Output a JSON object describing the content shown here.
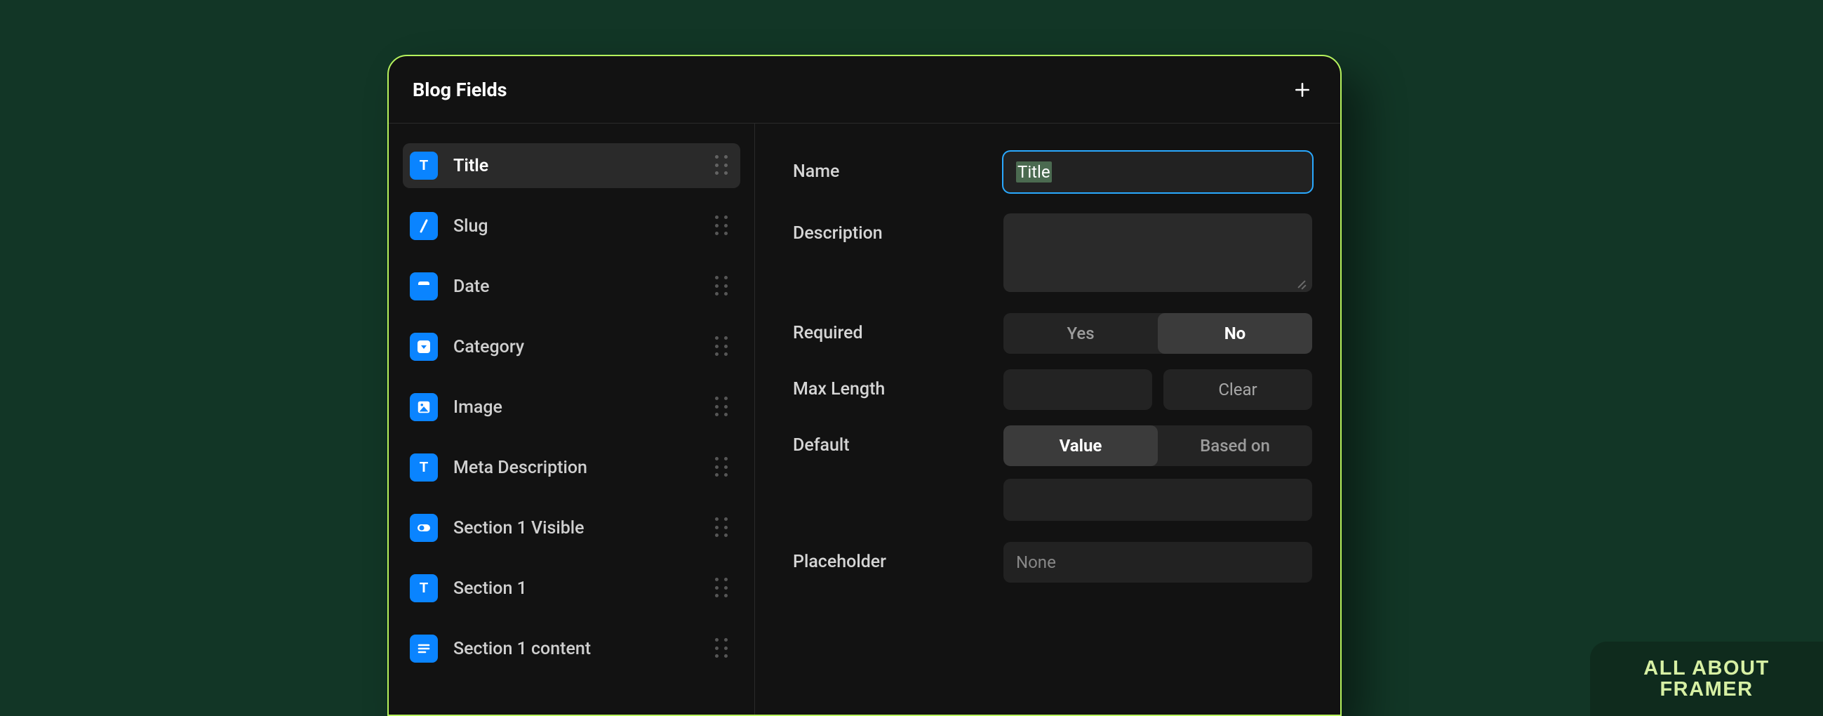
{
  "panel": {
    "title": "Blog Fields"
  },
  "fields": {
    "items": [
      {
        "label": "Title",
        "icon": "text",
        "selected": true
      },
      {
        "label": "Slug",
        "icon": "slash",
        "selected": false
      },
      {
        "label": "Date",
        "icon": "date",
        "selected": false
      },
      {
        "label": "Category",
        "icon": "dropdown",
        "selected": false
      },
      {
        "label": "Image",
        "icon": "image",
        "selected": false
      },
      {
        "label": "Meta Description",
        "icon": "text",
        "selected": false
      },
      {
        "label": "Section 1 Visible",
        "icon": "toggle",
        "selected": false
      },
      {
        "label": "Section 1",
        "icon": "text",
        "selected": false
      },
      {
        "label": "Section 1 content",
        "icon": "richtext",
        "selected": false
      }
    ]
  },
  "form": {
    "name": {
      "label": "Name",
      "value": "Title"
    },
    "description": {
      "label": "Description",
      "value": ""
    },
    "required": {
      "label": "Required",
      "options": {
        "yes": "Yes",
        "no": "No"
      },
      "selected": "no"
    },
    "max_length": {
      "label": "Max Length",
      "value": "",
      "clear_label": "Clear"
    },
    "default": {
      "label": "Default",
      "options": {
        "value": "Value",
        "based_on": "Based on"
      },
      "selected": "value",
      "value": ""
    },
    "placeholder": {
      "label": "Placeholder",
      "value": "None"
    }
  },
  "brand": {
    "line1": "ALL ABOUT",
    "line2": "FRAMER"
  },
  "colors": {
    "background": "#123626",
    "panel": "#121212",
    "panel_border": "#b6f25d",
    "accent_blue": "#0a84ff",
    "focus_ring": "#2aa9ff",
    "row_selected": "#2a2a2a"
  }
}
